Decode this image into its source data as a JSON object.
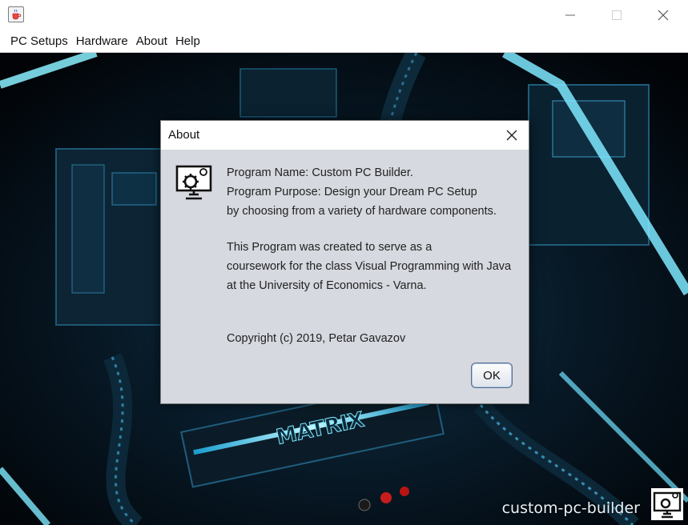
{
  "window": {
    "icon": "java-cup-icon",
    "controls": [
      "minimize-icon",
      "maximize-icon",
      "close-icon"
    ]
  },
  "menu": {
    "items": [
      {
        "label": "PC Setups"
      },
      {
        "label": "Hardware"
      },
      {
        "label": "About"
      },
      {
        "label": "Help"
      }
    ]
  },
  "background": {
    "brand_label": "custom-pc-builder",
    "logo_icon": "pc-gear-icon",
    "accent": "#2fd8ff"
  },
  "dialog": {
    "title": "About",
    "icon": "pc-gear-icon",
    "lines": [
      "Program Name: Custom PC Builder.",
      "Program Purpose: Design your Dream PC Setup",
      "by choosing from a variety of hardware components.",
      "This Program was created to serve as a",
      "coursework for the class Visual Programming with Java",
      "at the University of Economics - Varna.",
      "Copyright (c) 2019, Petar Gavazov"
    ],
    "ok_label": "OK"
  }
}
